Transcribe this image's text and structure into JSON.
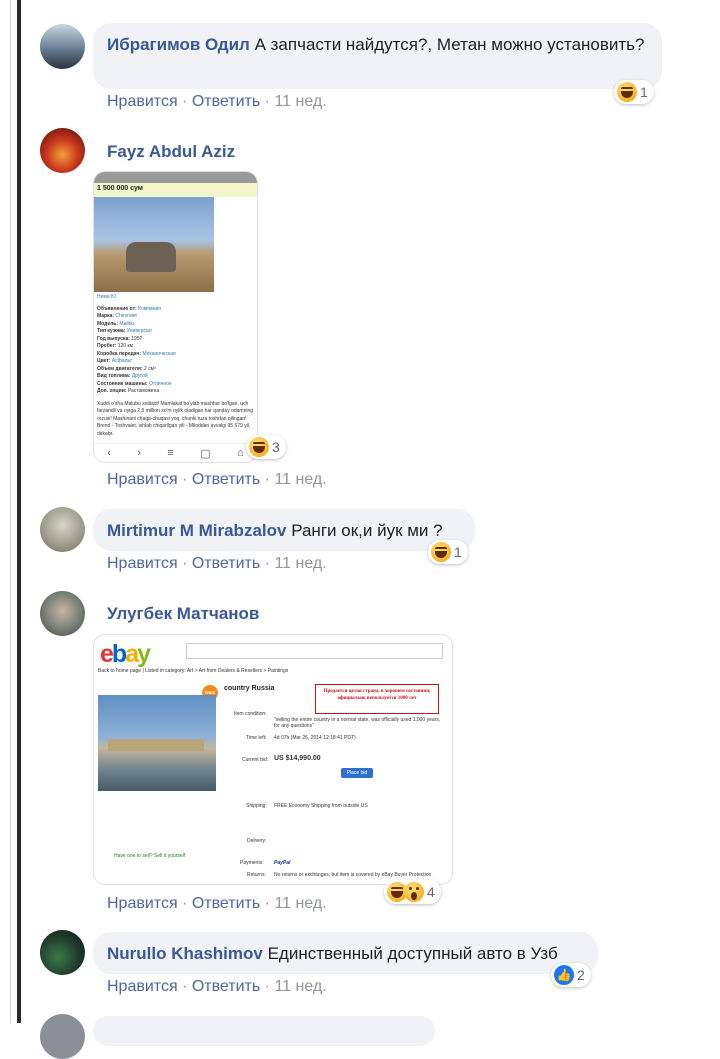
{
  "comments": [
    {
      "author": "Ибрагимов Одил",
      "text": "А запчасти найдутся?, Метан можно установить?",
      "actions": {
        "like": "Нравится",
        "reply": "Ответить",
        "time": "11 нед."
      },
      "reactions": {
        "count": "1",
        "icons": [
          "haha-icon"
        ]
      },
      "avatar_color": "#3b4a5c"
    },
    {
      "author": "Fayz Abdul Aziz",
      "actions": {
        "like": "Нравится",
        "reply": "Ответить",
        "time": "11 нед."
      },
      "reactions": {
        "count": "3",
        "icons": [
          "haha-icon"
        ]
      },
      "avatar_color": "#a5231c",
      "attachment": {
        "price": "1 500 000 сум",
        "link_text": "Нема Ю",
        "specs": [
          {
            "label": "Объявление от:",
            "value": "Компания"
          },
          {
            "label": "Марка:",
            "value": "Chevrolet"
          },
          {
            "label": "Модель:",
            "value": "Malibu"
          },
          {
            "label": "Тип кузова:",
            "value": "Универсал"
          },
          {
            "label": "Год выпуска:",
            "value": "1957"
          },
          {
            "label": "Пробег:",
            "value": "120 км"
          },
          {
            "label": "Коробка передач:",
            "value": "Механическая"
          },
          {
            "label": "Цвет:",
            "value": "Асфальт"
          },
          {
            "label": "Объем двигателя:",
            "value": "2 см³"
          },
          {
            "label": "Вид топлива:",
            "value": "Другой"
          },
          {
            "label": "Состояние машины:",
            "value": "Отличное"
          },
          {
            "label": "Доп. опции:",
            "value": "Растаможена"
          }
        ],
        "description": "Xuddi o'sha Malubo sotiladi! Mamlakat bo'ylab mashhur bo'lgan, uch farzandli va oyiga 2,5 million so'm oylik oladigan har qanday odamning orzusi! Mashinani chaqa-chuqasi yoq, chunki tuza toshdan qilingan! Brend - Toshvalet, ishlab chiqarilgan yili - Miloddan avvalgi 95 679 yil, dekabr."
      }
    },
    {
      "author": "Mirtimur M Mirabzalov",
      "text": "Ранги ок,и йук ми ?",
      "actions": {
        "like": "Нравится",
        "reply": "Ответить",
        "time": "11 нед."
      },
      "reactions": {
        "count": "1",
        "icons": [
          "haha-icon"
        ]
      },
      "avatar_color": "#9a9a8e"
    },
    {
      "author": "Улугбек Матчанов",
      "actions": {
        "like": "Нравится",
        "reply": "Ответить",
        "time": "11 нед."
      },
      "reactions": {
        "count": "4",
        "icons": [
          "haha-icon",
          "wow-icon"
        ]
      },
      "avatar_color": "#6f7770",
      "attachment": {
        "logo": "ebay",
        "breadcrumb": "Back to home page | Listed in category: Art > Art from Dealers & Resellers > Paintings",
        "title": "country Russia",
        "red_note": "Продается целая страна, в хорошем состоянии, официально непользуется 1000 лет",
        "condition_label": "Item condition:",
        "condition_text": "\"selling the entire country in a normal state, was officially used 1,000 years, for any questions\"",
        "time_left_label": "Time left:",
        "time_left": "4d 07h (Mar 26, 2014 12:18:41 PDT)",
        "price_label": "Current bid:",
        "price": "US $14,990.00",
        "bid_button": "Place bid",
        "shipping_label": "Shipping:",
        "shipping": "FREE Economy Shipping from outside US",
        "delivery_label": "Delivery:",
        "payments_label": "Payments:",
        "payments": "PayPal",
        "returns_label": "Returns:",
        "returns": "No returns or exchanges, but item is covered by eBay Buyer Protection",
        "sell_text": "Have one to sell? Sell it yourself"
      }
    },
    {
      "author": "Nurullo Khashimov",
      "text": "Единственный доступный авто в Узб",
      "actions": {
        "like": "Нравится",
        "reply": "Ответить",
        "time": "11 нед."
      },
      "reactions": {
        "count": "2",
        "icons": [
          "like-icon"
        ]
      },
      "avatar_color": "#2b4a3a"
    }
  ],
  "separator": " · "
}
